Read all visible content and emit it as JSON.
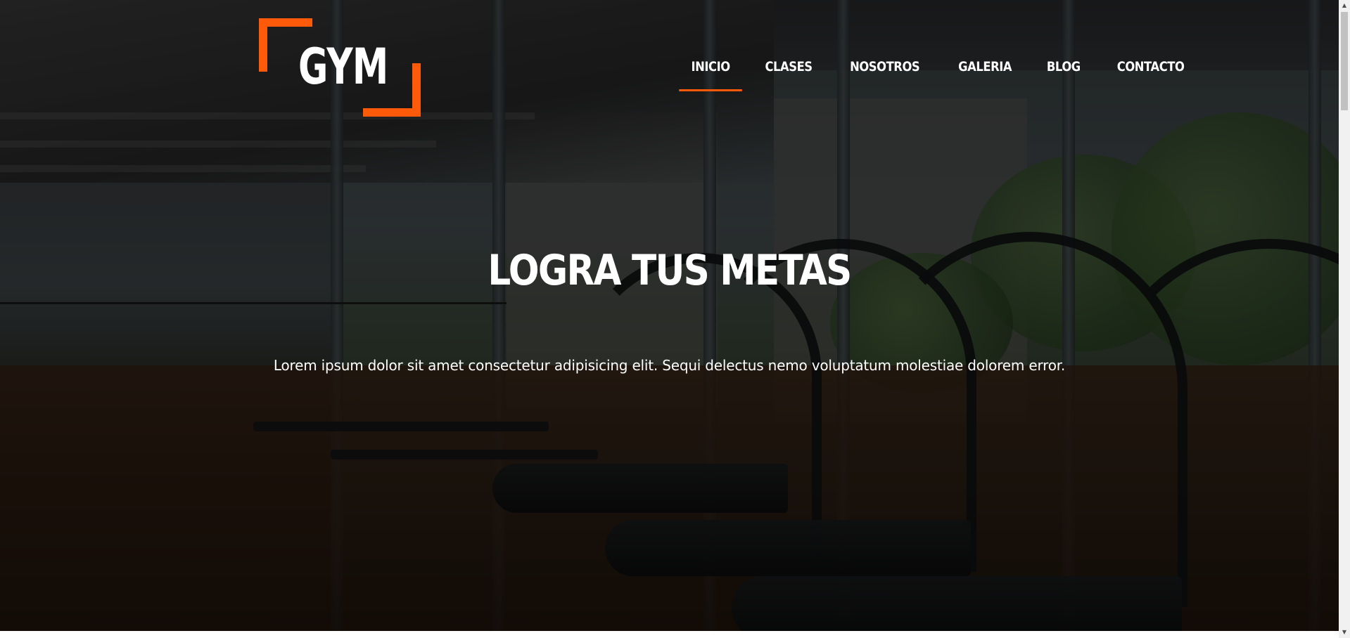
{
  "brand": {
    "logo_text": "GYM",
    "accent_color": "#ff5a0a"
  },
  "nav": {
    "items": [
      {
        "label": "INICIO",
        "active": true
      },
      {
        "label": "CLASES",
        "active": false
      },
      {
        "label": "NOSOTROS",
        "active": false
      },
      {
        "label": "GALERIA",
        "active": false
      },
      {
        "label": "BLOG",
        "active": false
      },
      {
        "label": "CONTACTO",
        "active": false
      }
    ]
  },
  "hero": {
    "title": "LOGRA TUS METAS",
    "text": "Lorem ipsum dolor sit amet consectetur adipisicing elit. Sequi delectus nemo voluptatum molestiae dolorem error.",
    "background": "gym-interior-image"
  },
  "scrollbar": {
    "up_icon": "arrow-up-icon",
    "down_icon": "arrow-down-icon"
  }
}
